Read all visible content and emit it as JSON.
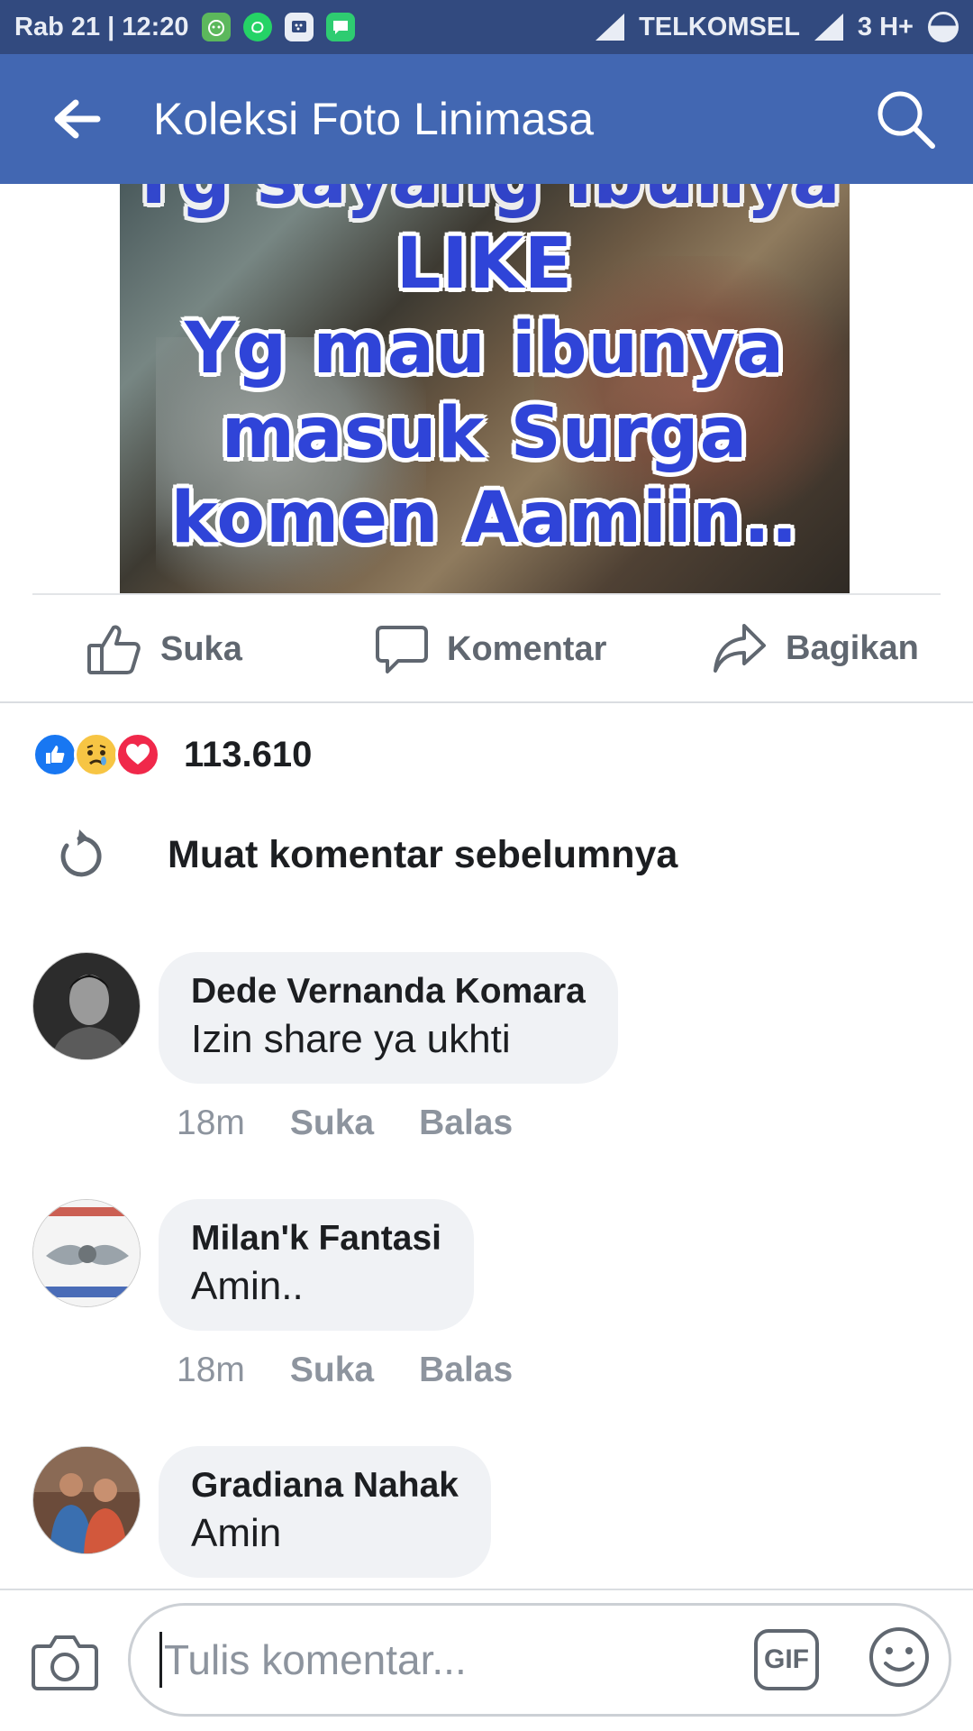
{
  "status_bar": {
    "left_text": "Rab 21 | 12:20",
    "carrier": "TELKOMSEL",
    "network": "3 H+",
    "icons": [
      "notification-app-icon",
      "whatsapp-icon",
      "bbm-icon",
      "chat-icon",
      "signal-icon",
      "battery-icon"
    ]
  },
  "app_bar": {
    "title": "Koleksi Foto Linimasa",
    "back_icon": "arrow-left-icon",
    "search_icon": "search-icon",
    "background": "#4267b2"
  },
  "post_image": {
    "lines": [
      "LIKE",
      "Yg mau ibunya",
      "masuk Surga",
      "komen Aamiin.."
    ],
    "text_color": "#2f44d8"
  },
  "actions": {
    "like_label": "Suka",
    "comment_label": "Komentar",
    "share_label": "Bagikan"
  },
  "reactions": {
    "types": [
      "like",
      "sad",
      "love"
    ],
    "count": "113.610"
  },
  "load_previous": {
    "label": "Muat komentar sebelumnya"
  },
  "comments": [
    {
      "name": "Dede Vernanda Komara",
      "text": "Izin share  ya ukhti",
      "time": "18m",
      "like_label": "Suka",
      "reply_label": "Balas"
    },
    {
      "name": "Milan'k Fantasi",
      "text": "Amin..",
      "time": "18m",
      "like_label": "Suka",
      "reply_label": "Balas"
    },
    {
      "name": "Gradiana Nahak",
      "text": "Amin"
    }
  ],
  "composer": {
    "placeholder": "Tulis komentar...",
    "gif_label": "GIF"
  }
}
